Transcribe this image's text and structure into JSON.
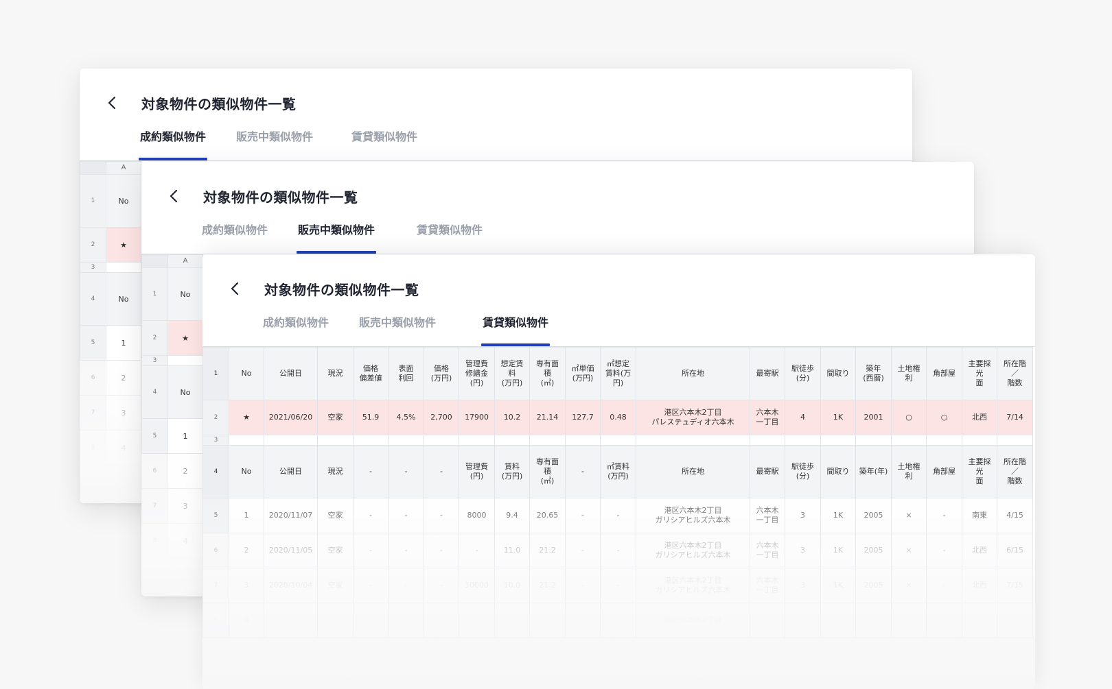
{
  "page_title": "対象物件の類似物件一覧",
  "tabs": [
    "成約類似物件",
    "販売中類似物件",
    "賃貸類似物件"
  ],
  "mini_sheet": {
    "col_letter": "A",
    "rows": [
      {
        "rn": "1",
        "val": "No"
      },
      {
        "rn": "2",
        "val": "★"
      },
      {
        "rn": "3",
        "val": ""
      },
      {
        "rn": "4",
        "val": "No"
      },
      {
        "rn": "5",
        "val": "1"
      },
      {
        "rn": "6",
        "val": "2"
      },
      {
        "rn": "7",
        "val": "3"
      },
      {
        "rn": "8",
        "val": "4"
      }
    ]
  },
  "rental_table": {
    "header1": [
      "1",
      "No",
      "公開日",
      "現況",
      "価格\n偏差値",
      "表面\n利回",
      "価格\n(万円)",
      "管理費\n修繕金\n(円)",
      "想定賃\n料\n(万円)",
      "専有面\n積\n(㎡)",
      "㎡単価\n(万円)",
      "㎡想定\n賃料(万\n円)",
      "所在地",
      "最寄駅",
      "駅徒歩\n(分)",
      "間取り",
      "築年\n(西暦)",
      "土地権\n利",
      "角部屋",
      "主要採\n光\n面",
      "所在階\n／\n階数"
    ],
    "target_row": [
      "2",
      "★",
      "2021/06/20",
      "空家",
      "51.9",
      "4.5%",
      "2,700",
      "17900",
      "10.2",
      "21.14",
      "127.7",
      "0.48",
      "港区六本木2丁目\nパレステュディオ六本木",
      "六本木\n一丁目",
      "4",
      "1K",
      "2001",
      "○",
      "○",
      "北西",
      "7/14"
    ],
    "spacer_row": "3",
    "header2": [
      "4",
      "No",
      "公開日",
      "現況",
      "-",
      "-",
      "-",
      "管理費\n(円)",
      "賃料\n(万円)",
      "専有面\n積\n(㎡)",
      "-",
      "㎡賃料\n(万円)",
      "所在地",
      "最寄駅",
      "駅徒歩\n(分)",
      "間取り",
      "築年(年)",
      "土地権\n利",
      "角部屋",
      "主要採\n光\n面",
      "所在階\n／\n階数"
    ],
    "rows": [
      [
        "5",
        "1",
        "2020/11/07",
        "空家",
        "-",
        "-",
        "-",
        "8000",
        "9.4",
        "20.65",
        "-",
        "-",
        "港区六本木2丁目\nガリシアヒルズ六本木",
        "六本木\n一丁目",
        "3",
        "1K",
        "2005",
        "×",
        "-",
        "南東",
        "4/15"
      ],
      [
        "6",
        "2",
        "2020/11/05",
        "空家",
        "-",
        "-",
        "-",
        "-",
        "11.0",
        "21.2",
        "-",
        "-",
        "港区六本木2丁目\nガリシアヒルズ六本木",
        "六本木\n一丁目",
        "3",
        "1K",
        "2005",
        "×",
        "-",
        "北西",
        "6/15"
      ],
      [
        "7",
        "3",
        "2020/10/04",
        "空家",
        "-",
        "-",
        "-",
        "10000",
        "10.0",
        "21.2",
        "-",
        "-",
        "港区六本木2丁目\nガリシアヒルズ六本木",
        "六本木\n一丁目",
        "3",
        "1K",
        "2005",
        "×",
        "-",
        "北西",
        "7/15"
      ],
      [
        "8",
        "4",
        "",
        "",
        "",
        "",
        "",
        "",
        "",
        "",
        "",
        "",
        "港区六本木2丁目",
        "",
        "",
        "",
        "",
        "",
        "",
        "",
        ""
      ]
    ]
  }
}
